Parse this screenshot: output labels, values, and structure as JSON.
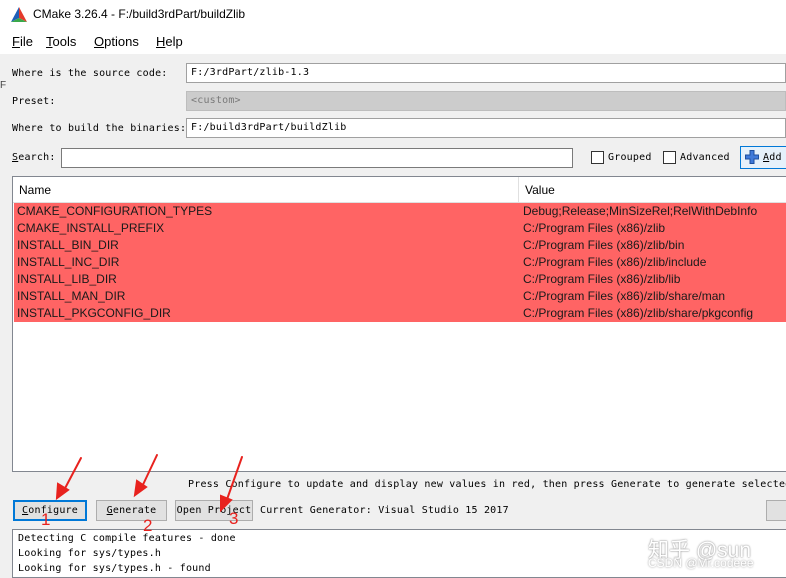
{
  "window": {
    "title": "CMake 3.26.4 - F:/build3rdPart/buildZlib",
    "icon": "cmake-triangle-icon"
  },
  "menu": {
    "items": [
      {
        "key": "F",
        "rest": "ile"
      },
      {
        "key": "T",
        "rest": "ools"
      },
      {
        "key": "O",
        "rest": "ptions"
      },
      {
        "key": "H",
        "rest": "elp"
      }
    ]
  },
  "edge_mark": "F",
  "paths": {
    "source_label": "Where is the source code:",
    "source_value": "F:/3rdPart/zlib-1.3",
    "preset_label": "Preset:",
    "preset_value": "<custom>",
    "binaries_label": "Where to build the binaries:",
    "binaries_value": "F:/build3rdPart/buildZlib"
  },
  "search": {
    "label_key": "S",
    "label_rest": "earch:",
    "value": ""
  },
  "options": {
    "grouped_label": "Grouped",
    "grouped_checked": false,
    "advanced_label": "Advanced",
    "advanced_checked": false,
    "add_label_key": "A",
    "add_label_rest": "dd",
    "add_icon": "plus-icon"
  },
  "table": {
    "headers": {
      "name": "Name",
      "value": "Value"
    },
    "highlight_color": "#ff6464",
    "rows": [
      {
        "name": "CMAKE_CONFIGURATION_TYPES",
        "value": "Debug;Release;MinSizeRel;RelWithDebInfo"
      },
      {
        "name": "CMAKE_INSTALL_PREFIX",
        "value": "C:/Program Files (x86)/zlib"
      },
      {
        "name": "INSTALL_BIN_DIR",
        "value": "C:/Program Files (x86)/zlib/bin"
      },
      {
        "name": "INSTALL_INC_DIR",
        "value": "C:/Program Files (x86)/zlib/include"
      },
      {
        "name": "INSTALL_LIB_DIR",
        "value": "C:/Program Files (x86)/zlib/lib"
      },
      {
        "name": "INSTALL_MAN_DIR",
        "value": "C:/Program Files (x86)/zlib/share/man"
      },
      {
        "name": "INSTALL_PKGCONFIG_DIR",
        "value": "C:/Program Files (x86)/zlib/share/pkgconfig"
      }
    ]
  },
  "hint": "Press Configure to update and display new values in red, then press Generate to generate selected bu",
  "buttons": {
    "configure_key": "C",
    "configure_rest": "onfigure",
    "generate_key": "G",
    "generate_rest": "enerate",
    "open_project_label": "Open Project"
  },
  "generator_label": "Current Generator: Visual Studio 15 2017",
  "log": [
    "Detecting C compile features - done",
    "Looking for sys/types.h",
    "Looking for sys/types.h - found"
  ],
  "annotations": {
    "color": "#e8221e",
    "labels": [
      "1",
      "2",
      "3"
    ]
  },
  "watermark": {
    "main": "知乎 @sun",
    "sub": "CSDN @Mr.codeee"
  }
}
